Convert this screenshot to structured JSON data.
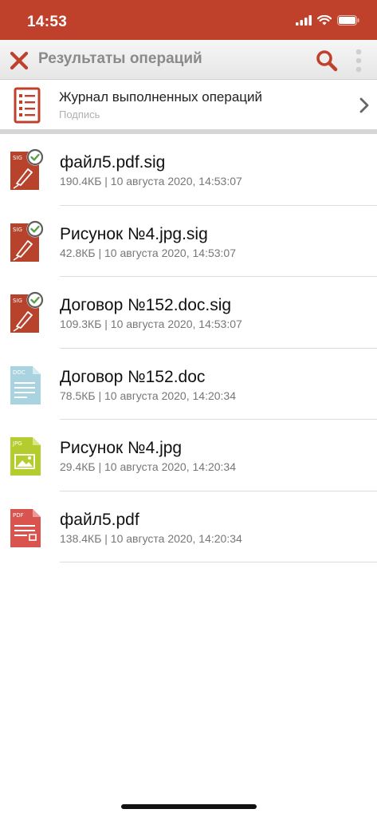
{
  "status_bar": {
    "time": "14:53"
  },
  "header": {
    "title": "Результаты операций"
  },
  "journal": {
    "title": "Журнал выполненных операций",
    "subtitle": "Подпись"
  },
  "files": [
    {
      "name": "файл5.pdf.sig",
      "meta": "190.4КБ | 10 августа 2020, 14:53:07",
      "icon": "sig-file-icon",
      "badge": "SIG"
    },
    {
      "name": "Рисунок №4.jpg.sig",
      "meta": "42.8КБ | 10 августа 2020, 14:53:07",
      "icon": "sig-file-icon",
      "badge": "SIG"
    },
    {
      "name": "Договор №152.doc.sig",
      "meta": "109.3КБ | 10 августа 2020, 14:53:07",
      "icon": "sig-file-icon",
      "badge": "SIG"
    },
    {
      "name": "Договор №152.doc",
      "meta": "78.5КБ | 10 августа 2020, 14:20:34",
      "icon": "doc-file-icon",
      "badge": "DOC"
    },
    {
      "name": "Рисунок №4.jpg",
      "meta": "29.4КБ | 10 августа 2020, 14:20:34",
      "icon": "jpg-file-icon",
      "badge": "JPG"
    },
    {
      "name": "файл5.pdf",
      "meta": "138.4КБ | 10 августа 2020, 14:20:34",
      "icon": "pdf-file-icon",
      "badge": "PDF"
    }
  ],
  "colors": {
    "accent": "#c0412b",
    "sig": "#b8432c",
    "doc": "#a9d3e0",
    "jpg": "#b5cc2e",
    "pdf": "#d9534f"
  }
}
